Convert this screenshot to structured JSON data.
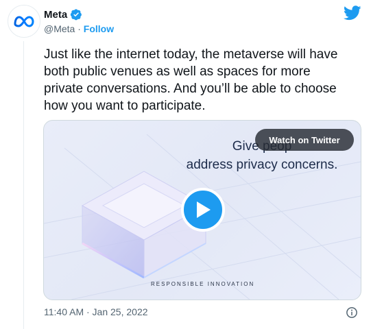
{
  "author": {
    "name": "Meta",
    "handle": "@Meta",
    "separator": "·",
    "follow_label": "Follow"
  },
  "tweet": {
    "text": "Just like the internet today, the metaverse will have\nboth public venues as well as spaces for more\nprivate conversations. And you’ll be able to choose\nhow you want to participate."
  },
  "media": {
    "headline": "Give peop\naddress privacy concerns.",
    "watch_label": "Watch on Twitter",
    "caption": "RESPONSIBLE INNOVATION"
  },
  "footer": {
    "timestamp": "11:40 AM · Jan 25, 2022"
  },
  "colors": {
    "accent": "#1d9bf0",
    "text": "#0f1419",
    "muted": "#536471"
  },
  "icons": [
    "meta-logo-icon",
    "verified-badge-icon",
    "twitter-bird-icon",
    "play-icon",
    "info-icon"
  ]
}
